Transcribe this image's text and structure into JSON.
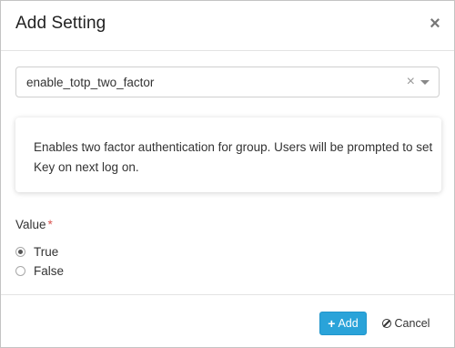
{
  "modal": {
    "title": "Add Setting",
    "close_label": "×"
  },
  "setting_select": {
    "value": "enable_totp_two_factor",
    "clear_label": "×"
  },
  "description": "Enables two factor authentication for group. Users will be prompted to set Key on next log on.",
  "value_field": {
    "label": "Value",
    "required_mark": "*",
    "options": [
      {
        "label": "True",
        "checked": true
      },
      {
        "label": "False",
        "checked": false
      }
    ]
  },
  "footer": {
    "add_icon": "plus-icon",
    "add_label": "Add",
    "cancel_icon": "ban-icon",
    "cancel_label": "Cancel"
  },
  "colors": {
    "primary_button": "#2aa3d9",
    "required": "#d9534f"
  }
}
